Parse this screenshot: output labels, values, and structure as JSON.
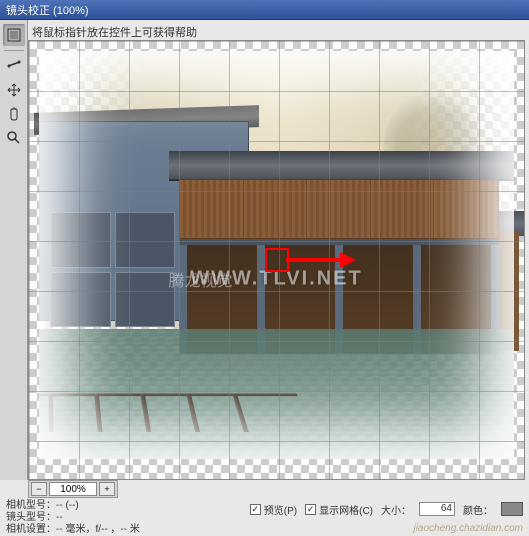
{
  "title": "镜头校正 (100%)",
  "hint": "将鼠标指针放在控件上可获得帮助",
  "zoom": {
    "value": "100%",
    "minus": "−",
    "plus": "+"
  },
  "info": {
    "camera_model_label": "相机型号：",
    "camera_model_value": "-- (--)",
    "lens_model_label": "镜头型号：",
    "lens_model_value": "--",
    "camera_settings_label": "相机设置：",
    "camera_settings_value": "-- 毫米，f/-- ，-- 米"
  },
  "options": {
    "preview_label": "预览(P)",
    "preview_checked": true,
    "grid_label": "显示网格(C)",
    "grid_checked": true,
    "size_label": "大小：",
    "size_value": "64",
    "color_label": "颜色："
  },
  "watermark": {
    "en": "WWW.TLVI.NET",
    "cn": "腾龙视觉"
  },
  "footer": "jiaocheng.chazidian.com",
  "icons": {
    "tool1": "lens-correct-icon",
    "tool2": "crop-icon",
    "tool3": "hand-icon",
    "tool4": "zoom-icon"
  }
}
